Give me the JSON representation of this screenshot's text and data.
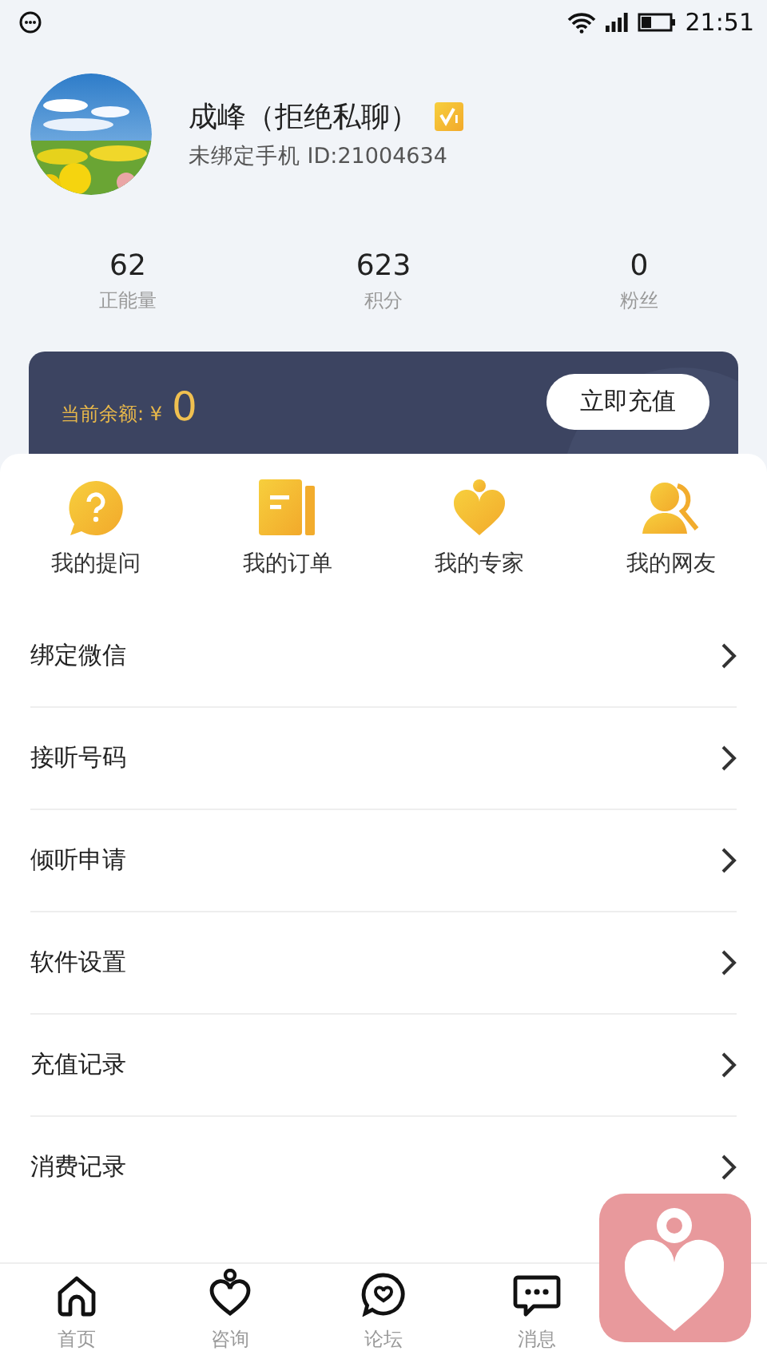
{
  "status_bar": {
    "time": "21:51"
  },
  "profile": {
    "name": "成峰（拒绝私聊）",
    "verified": true,
    "subtitle": "未绑定手机 ID:21004634"
  },
  "stats": [
    {
      "value": "62",
      "label": "正能量"
    },
    {
      "value": "623",
      "label": "积分"
    },
    {
      "value": "0",
      "label": "粉丝"
    }
  ],
  "balance": {
    "label": "当前余额: ¥",
    "amount": "0",
    "button": "立即充值"
  },
  "shortcuts": [
    {
      "label": "我的提问",
      "kind": "question"
    },
    {
      "label": "我的订单",
      "kind": "order"
    },
    {
      "label": "我的专家",
      "kind": "expert"
    },
    {
      "label": "我的网友",
      "kind": "friends"
    }
  ],
  "menu": [
    {
      "label": "绑定微信"
    },
    {
      "label": "接听号码"
    },
    {
      "label": "倾听申请"
    },
    {
      "label": "软件设置"
    },
    {
      "label": "充值记录"
    },
    {
      "label": "消费记录"
    }
  ],
  "tab_bar": [
    {
      "label": "首页",
      "kind": "home",
      "selected": false
    },
    {
      "label": "咨询",
      "kind": "consult",
      "selected": false
    },
    {
      "label": "论坛",
      "kind": "forum",
      "selected": false
    },
    {
      "label": "消息",
      "kind": "message",
      "selected": false
    }
  ]
}
